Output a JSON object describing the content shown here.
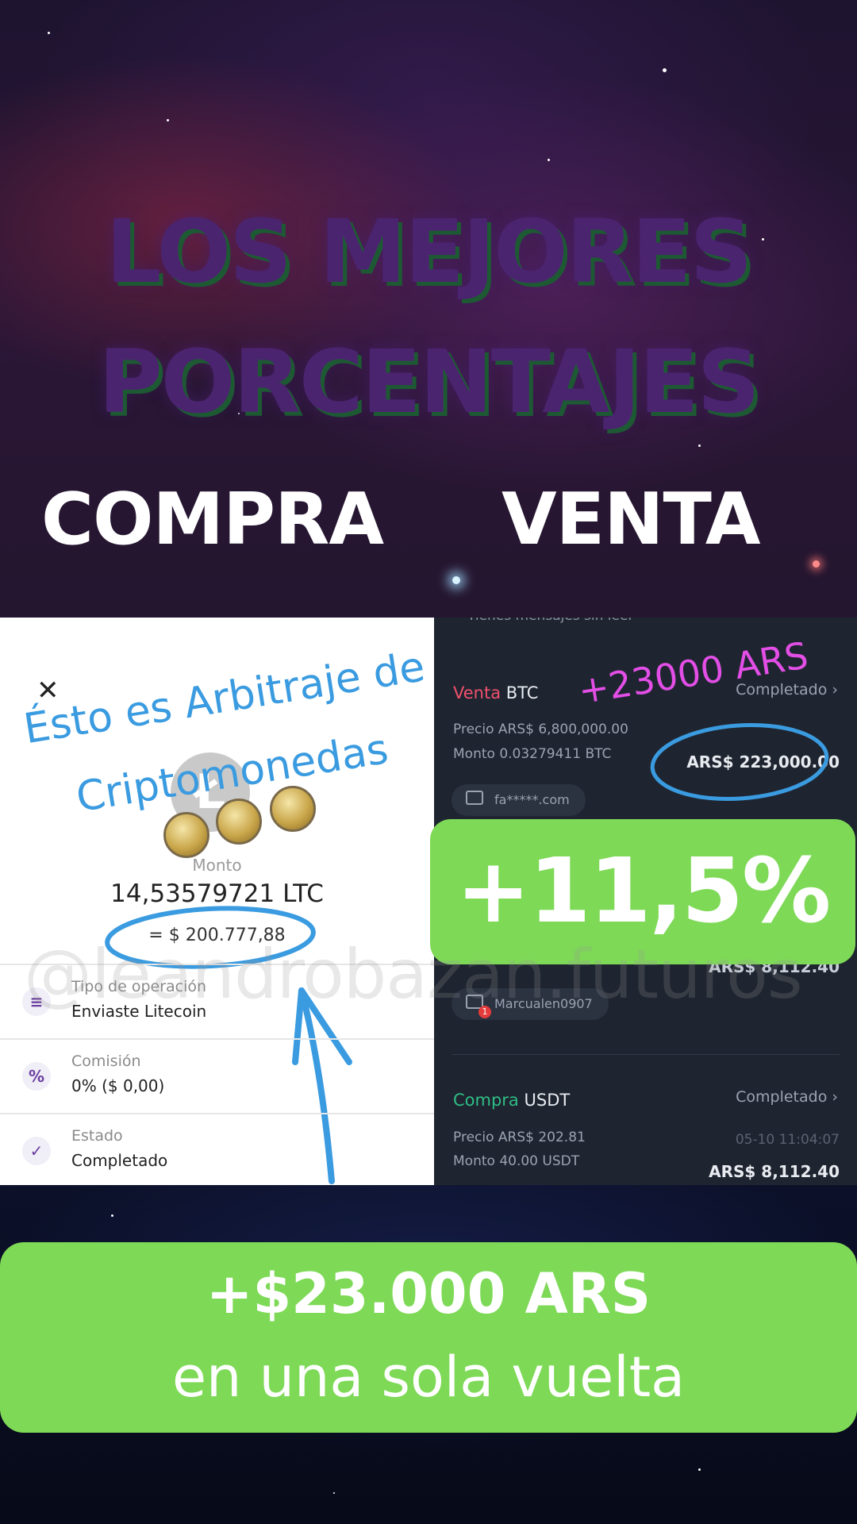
{
  "headline": {
    "line1": "LOS MEJORES",
    "line2": "PORCENTAJES"
  },
  "columns": {
    "buy": "COMPRA",
    "sell": "VENTA"
  },
  "left_panel": {
    "close_icon": "close-icon",
    "annotation_line1": "Ésto es Arbitraje de",
    "annotation_line2": "Criptomonedas",
    "coin_symbol": "Ł",
    "monto_label": "Monto",
    "monto_value": "14,53579721 LTC",
    "monto_fiat": "= $ 200.777,88",
    "rows": [
      {
        "icon": "list-icon",
        "glyph": "≡",
        "label": "Tipo de operación",
        "value": "Enviaste Litecoin"
      },
      {
        "icon": "percent-icon",
        "glyph": "%",
        "label": "Comisión",
        "value": "0% ($ 0,00)"
      },
      {
        "icon": "check-circle-icon",
        "glyph": "✓",
        "label": "Estado",
        "value": "Completado"
      }
    ]
  },
  "right_panel": {
    "top_message": "Tienes mensajes sin leer",
    "annotation": "+23000 ARS",
    "sell": {
      "side": "Venta",
      "asset": "BTC",
      "status": "Completado",
      "price": "Precio ARS$ 6,800,000.00",
      "amount_line": "Monto 0.03279411 BTC",
      "total": "ARS$ 223,000.00",
      "chip": "fa*****.com"
    },
    "hidden_total": "ARS$ 8,112.40",
    "chip2": "Marcualen0907",
    "chip2_badge": "1",
    "buy": {
      "side": "Compra",
      "asset": "USDT",
      "status": "Completado",
      "price": "Precio ARS$ 202.81",
      "amount_line": "Monto 40.00 USDT",
      "timestamp": "05-10 11:04:07",
      "total": "ARS$ 8,112.40"
    },
    "colors": {
      "sell": "#f0506e",
      "buy": "#2ebd85"
    }
  },
  "profit_percent": "+11,5%",
  "watermark": "@leandrobazan.futuros",
  "bottom": {
    "line1": "+$23.000 ARS",
    "line2": "en una sola vuelta"
  },
  "colors": {
    "accent_green": "#7ed957",
    "headline_purple": "#4b2470",
    "annotation_blue": "#3a9be0",
    "annotation_pink": "#e24ee6"
  }
}
